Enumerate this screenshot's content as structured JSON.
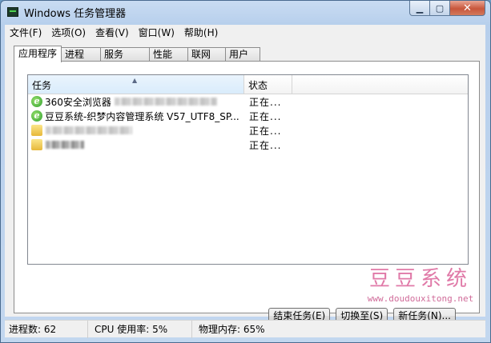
{
  "window": {
    "title": "Windows 任务管理器",
    "caption": {
      "minimize": "▁",
      "maximize": "▢",
      "close": "✕"
    }
  },
  "menubar": {
    "items": [
      "文件(F)",
      "选项(O)",
      "查看(V)",
      "窗口(W)",
      "帮助(H)"
    ]
  },
  "tabs": [
    {
      "label": "应用程序",
      "active": true
    },
    {
      "label": "进程",
      "active": false
    },
    {
      "label": "服务",
      "active": false
    },
    {
      "label": "性能",
      "active": false
    },
    {
      "label": "联网",
      "active": false
    },
    {
      "label": "用户",
      "active": false
    }
  ],
  "list": {
    "columns": {
      "task": "任务",
      "status": "状态"
    },
    "rows": [
      {
        "icon": "browser-icon",
        "task": "360安全浏览器",
        "status": "正在..."
      },
      {
        "icon": "browser-icon",
        "task": "豆豆系统-织梦内容管理系统 V57_UTF8_SP...",
        "status": "正在..."
      },
      {
        "icon": "folder-icon",
        "task": "",
        "status": "正在..."
      },
      {
        "icon": "folder-icon",
        "task": "",
        "status": "正在..."
      }
    ]
  },
  "watermark": {
    "title": "豆豆系统",
    "url": "www.doudouxitong.net"
  },
  "buttons": {
    "end_task": "结束任务(E)",
    "switch_to": "切换至(S)",
    "new_task": "新任务(N)..."
  },
  "statusbar": {
    "processes": "进程数: 62",
    "cpu": "CPU 使用率: 5%",
    "memory": "物理内存: 65%"
  },
  "colors": {
    "titlebar": "#b7cfec",
    "close_button": "#c8563b",
    "watermark": "#e07aa8"
  }
}
